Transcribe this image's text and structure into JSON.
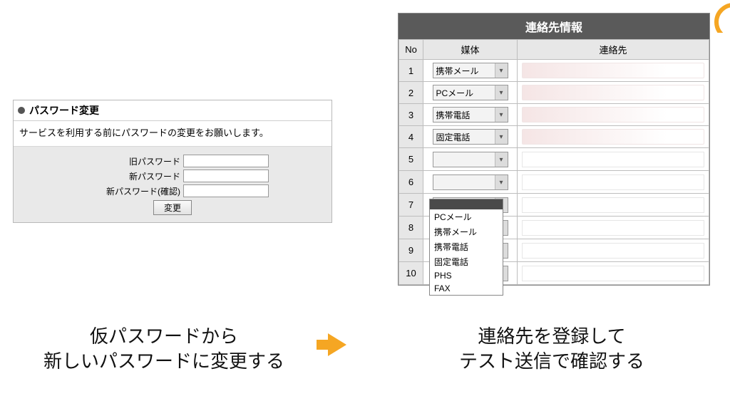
{
  "password_panel": {
    "title": "パスワード変更",
    "message": "サービスを利用する前にパスワードの変更をお願いします。",
    "fields": {
      "old_label": "旧パスワード",
      "new_label": "新パスワード",
      "confirm_label": "新パスワード(確認)"
    },
    "change_button": "変更"
  },
  "contact_panel": {
    "title": "連絡先情報",
    "columns": {
      "no": "No",
      "media": "媒体",
      "contact": "連絡先"
    },
    "rows": [
      {
        "no": "1",
        "media": "携帯メール",
        "faded": true
      },
      {
        "no": "2",
        "media": "PCメール",
        "faded": true
      },
      {
        "no": "3",
        "media": "携帯電話",
        "faded": true
      },
      {
        "no": "4",
        "media": "固定電話",
        "faded": true
      },
      {
        "no": "5",
        "media": "",
        "faded": false,
        "open": true
      },
      {
        "no": "6",
        "media": "",
        "faded": false
      },
      {
        "no": "7",
        "media": "",
        "faded": false
      },
      {
        "no": "8",
        "media": "",
        "faded": false
      },
      {
        "no": "9",
        "media": "",
        "faded": false
      },
      {
        "no": "10",
        "media": "",
        "faded": false
      }
    ],
    "dropdown_options": [
      "",
      "PCメール",
      "携帯メール",
      "携帯電話",
      "固定電話",
      "PHS",
      "FAX"
    ]
  },
  "captions": {
    "left_line1": "仮パスワードから",
    "left_line2": "新しいパスワードに変更する",
    "right_line1": "連絡先を登録して",
    "right_line2": "テスト送信で確認する"
  }
}
